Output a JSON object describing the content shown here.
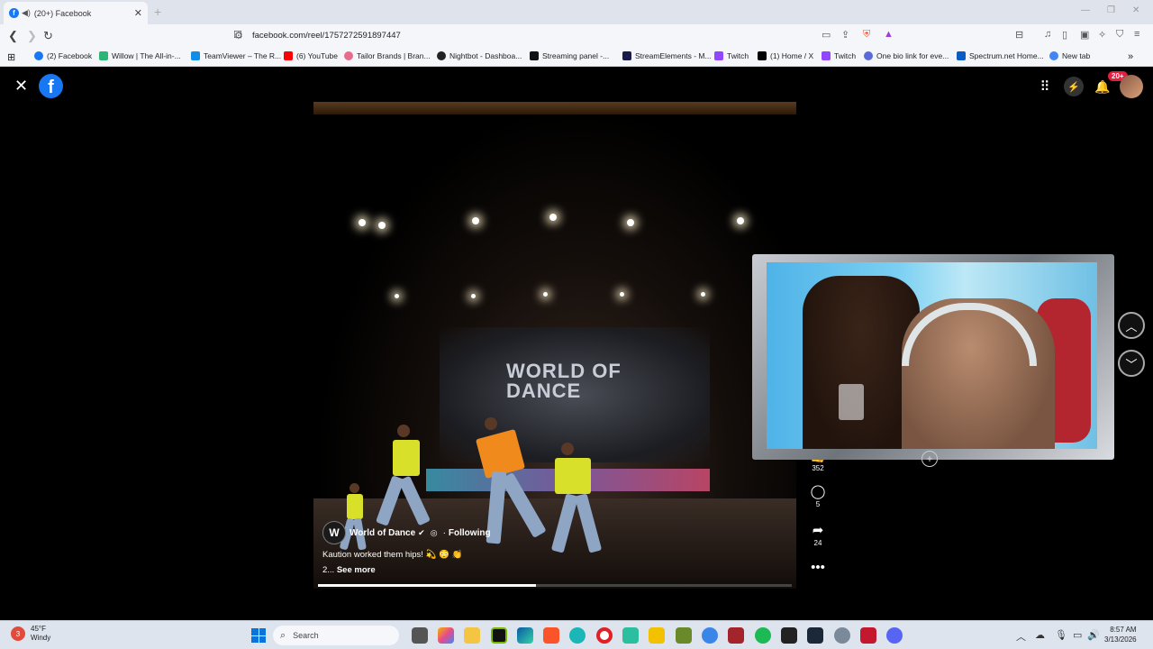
{
  "browser": {
    "tab_title": "(20+) Facebook",
    "url": "facebook.com/reel/1757272591897447"
  },
  "bookmarks": [
    {
      "label": "(2) Facebook",
      "color": "#1877f2"
    },
    {
      "label": "Willow | The All-in-...",
      "color": "#2bb673"
    },
    {
      "label": "TeamViewer – The R...",
      "color": "#0e8ee9"
    },
    {
      "label": "(6) YouTube",
      "color": "#ff0000"
    },
    {
      "label": "Tailor Brands | Bran...",
      "color": "#e86b8c"
    },
    {
      "label": "Nightbot - Dashboa...",
      "color": "#222222"
    },
    {
      "label": "Streaming panel -...",
      "color": "#111111"
    },
    {
      "label": "StreamElements - M...",
      "color": "#1b1b4a"
    },
    {
      "label": "Twitch",
      "color": "#9146ff"
    },
    {
      "label": "(1) Home / X",
      "color": "#000000"
    },
    {
      "label": "Twitch",
      "color": "#9146ff"
    },
    {
      "label": "One bio link for eve...",
      "color": "#5a6ad8"
    },
    {
      "label": "Spectrum.net Home...",
      "color": "#0b5cc7"
    },
    {
      "label": "New tab",
      "color": "#4285f4"
    }
  ],
  "facebook": {
    "notification_badge": "20+",
    "reel": {
      "channel_name": "World of Dance",
      "channel_initial": "W",
      "following_label": "Following",
      "caption": "Kaution worked them hips! 💫 😳 👏",
      "caption_more_prefix": "2...",
      "see_more_label": "See more",
      "progress": 0.46,
      "stage_text_line1": "WORLD OF",
      "stage_text_line2": "DANCE",
      "likes": "352",
      "comments": "5",
      "shares": "24"
    }
  },
  "taskbar": {
    "temperature": "45°F",
    "condition": "Windy",
    "weather_badge": "3",
    "search_placeholder": "Search",
    "time": "8:57 AM",
    "date": "3/13/2026"
  }
}
